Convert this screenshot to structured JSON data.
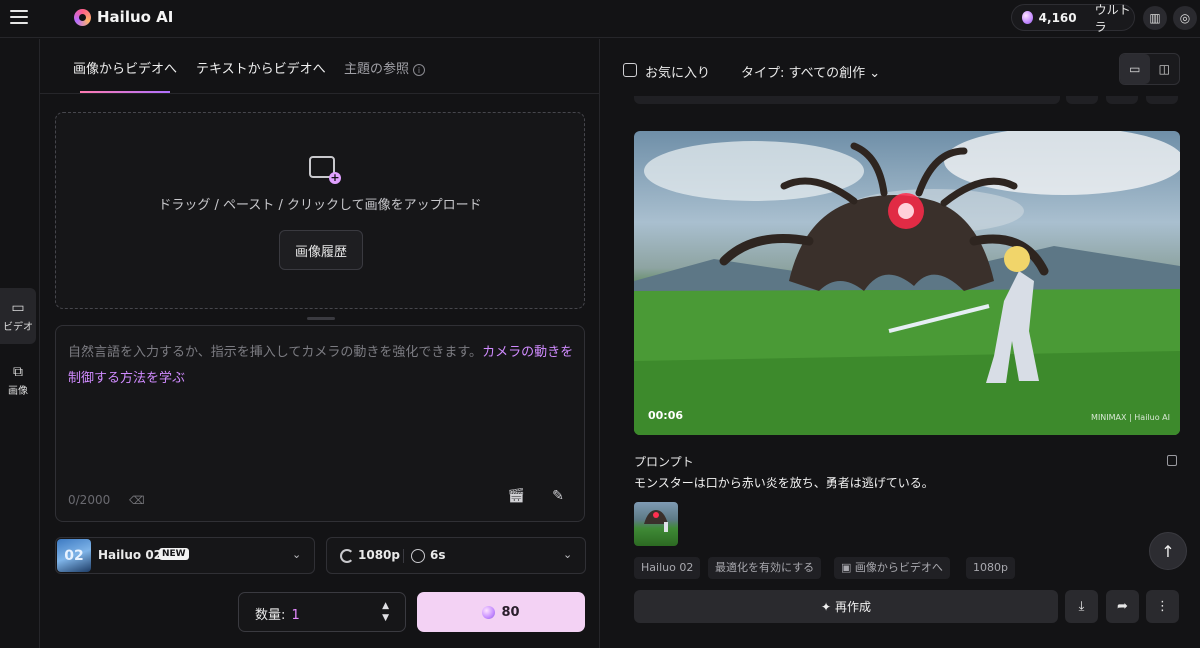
{
  "header": {
    "app_name": "Hailuo AI",
    "credits": "4,160",
    "plan": "ウルトラ"
  },
  "sidenav": {
    "items": [
      {
        "label": "ビデオ",
        "icon": "video-plus-icon"
      },
      {
        "label": "画像",
        "icon": "image-gen-icon"
      }
    ]
  },
  "tabs": {
    "image_to_video": "画像からビデオへ",
    "text_to_video": "テキストからビデオへ",
    "subject_reference": "主題の参照"
  },
  "upload": {
    "instruction": "ドラッグ / ペースト / クリックして画像をアップロード",
    "history_button": "画像履歴"
  },
  "prompt": {
    "placeholder": "自然言語を入力するか、指示を挿入してカメラの動きを強化できます。",
    "link": "カメラの動きを制御する方法を学ぶ",
    "char_count": "0/2000"
  },
  "model": {
    "thumb_text": "02",
    "name": "Hailuo 02",
    "badge": "NEW"
  },
  "settings": {
    "resolution": "1080p",
    "duration": "6s"
  },
  "quantity": {
    "label": "数量:",
    "value": "1"
  },
  "generate": {
    "cost": "80"
  },
  "gallery": {
    "favorites_label": "お気に入り",
    "type_filter": "タイプ: すべての創作",
    "video_time": "00:06",
    "watermark": "MINIMAX | Hailuo AI",
    "prompt_title": "プロンプト",
    "prompt_text": "モンスターは口から赤い炎を放ち、勇者は逃げている。",
    "tags": [
      "Hailuo 02",
      "最適化を有効にする",
      "画像からビデオへ",
      "1080p"
    ],
    "remake_label": "再作成"
  }
}
